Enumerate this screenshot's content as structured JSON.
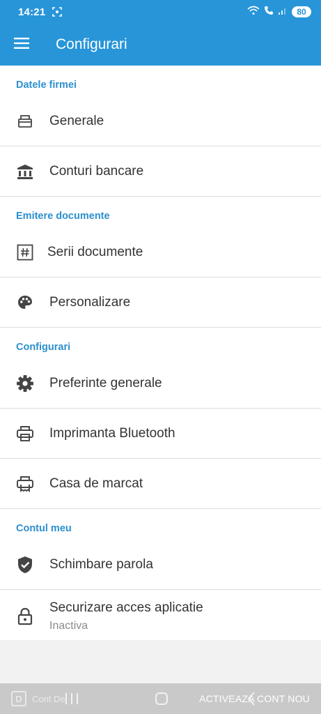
{
  "status_bar": {
    "time": "14:21",
    "battery": "80"
  },
  "app_bar": {
    "title": "Configurari"
  },
  "sections": {
    "company": {
      "header": "Datele firmei",
      "general": "Generale",
      "bank_accounts": "Conturi bancare"
    },
    "documents": {
      "header": "Emitere documente",
      "series": "Serii documente",
      "customize": "Personalizare"
    },
    "settings": {
      "header": "Configurari",
      "general_prefs": "Preferinte generale",
      "bluetooth_printer": "Imprimanta Bluetooth",
      "cash_register": "Casa de marcat"
    },
    "account": {
      "header": "Contul meu",
      "change_password": "Schimbare parola",
      "secure_access": "Securizare acces aplicatie",
      "secure_access_status": "Inactiva"
    }
  },
  "bottom_bar": {
    "demo_badge": "D",
    "demo_label": "Cont De",
    "activate_label": "ACTIVEAZA CONT NOU"
  },
  "colors": {
    "primary": "#2795d8",
    "section_header": "#2c8fcf",
    "divider": "#dcdcdc"
  }
}
